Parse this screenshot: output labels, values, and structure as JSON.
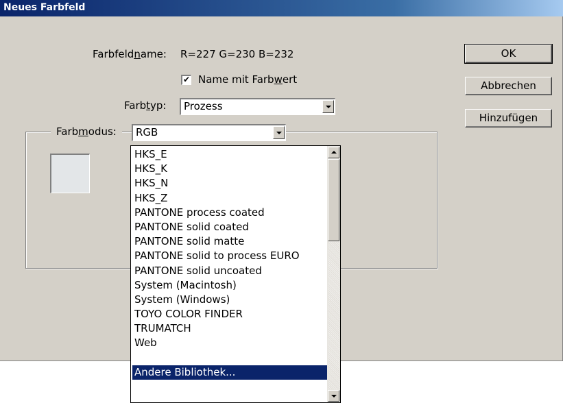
{
  "window": {
    "title": "Neues Farbfeld"
  },
  "form": {
    "name_label": "Farbfeldname:",
    "name_value": "R=227 G=230 B=232",
    "checkbox_label": "Name mit Farbwert",
    "checkbox_checked": true,
    "type_label": "Farbtyp:",
    "type_value": "Prozess",
    "mode_label": "Farbmodus:",
    "mode_value": "RGB"
  },
  "buttons": {
    "ok": "OK",
    "cancel": "Abbrechen",
    "add": "Hinzufügen"
  },
  "swatch": {
    "color": "#e3e6e8"
  },
  "dropdown": {
    "items": [
      "HKS_E",
      "HKS_K",
      "HKS_N",
      "HKS_Z",
      "PANTONE process coated",
      "PANTONE solid coated",
      "PANTONE solid matte",
      "PANTONE solid to process EURO",
      "PANTONE solid uncoated",
      "System (Macintosh)",
      "System (Windows)",
      "TOYO COLOR FINDER",
      "TRUMATCH",
      "Web",
      "",
      "Andere Bibliothek..."
    ],
    "selected_index": 15
  }
}
